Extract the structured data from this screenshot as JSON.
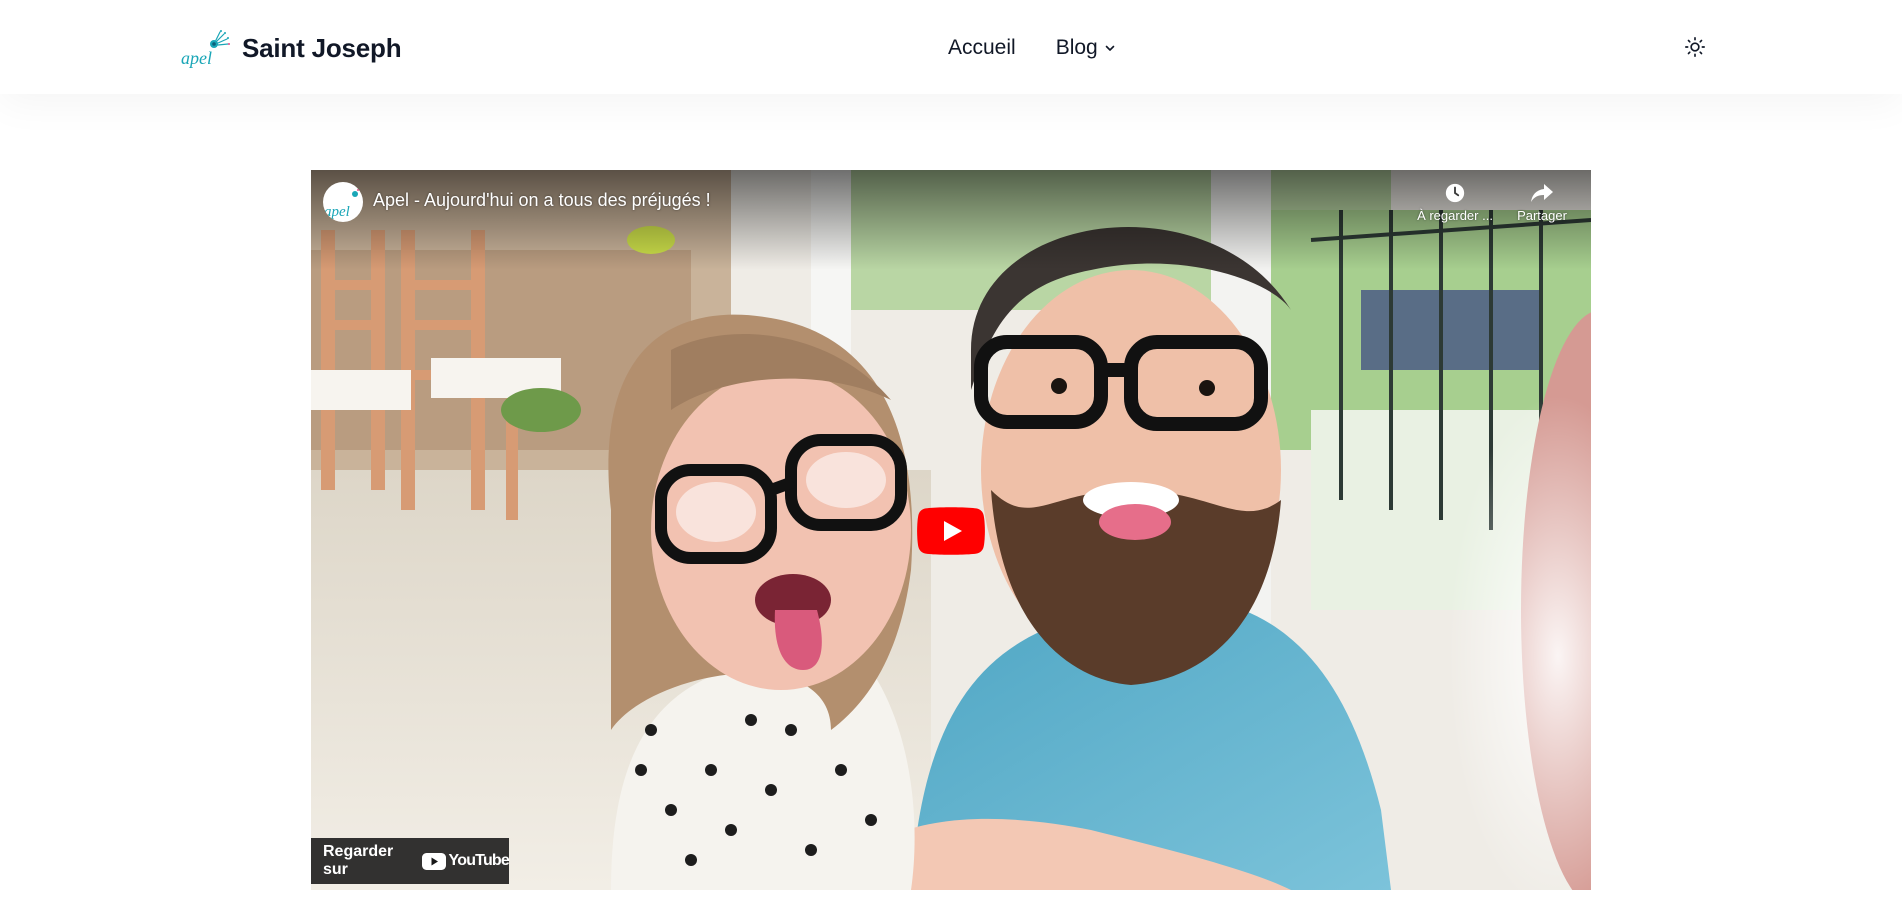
{
  "header": {
    "brand_logo_text": "apel",
    "brand_name": "Saint Joseph",
    "nav": [
      {
        "label": "Accueil"
      },
      {
        "label": "Blog"
      }
    ],
    "theme_toggle_icon": "sun-icon"
  },
  "video": {
    "channel_avatar_text": "apel",
    "title": "Apel - Aujourd'hui on a tous des préjugés !",
    "actions": [
      {
        "label": "À regarder ...",
        "icon": "clock-icon"
      },
      {
        "label": "Partager",
        "icon": "share-icon"
      }
    ],
    "play_icon": "play-icon",
    "watch_on_label": "Regarder sur",
    "youtube_label": "YouTube",
    "colors": {
      "play_red": "#ff0000",
      "brand_teal": "#1aa6b7"
    }
  }
}
